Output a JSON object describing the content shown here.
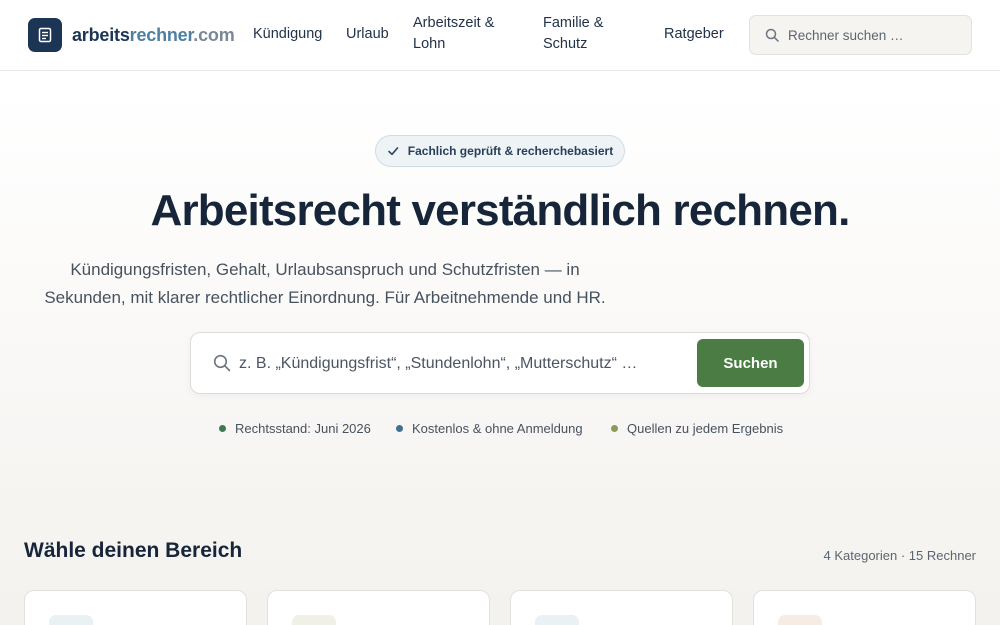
{
  "logo": {
    "part1": "arbeits",
    "part2": "rechner",
    "part3": ".com",
    "icon": "document-icon"
  },
  "nav": {
    "items": [
      {
        "label": "Kündigung"
      },
      {
        "label": "Urlaub"
      },
      {
        "label": "Arbeitszeit &",
        "label2": "Lohn"
      },
      {
        "label": "Familie &",
        "label2": "Schutz"
      },
      {
        "label": "Ratgeber"
      }
    ],
    "search_placeholder": "Rechner suchen …"
  },
  "hero": {
    "badge": "Fachlich geprüft & recherchebasiert",
    "title": "Arbeitsrecht verständlich rechnen.",
    "subtitle_line1": "Kündigungsfristen, Gehalt, Urlaubsanspruch und Schutzfristen — in",
    "subtitle_line2": "Sekunden, mit klarer rechtlicher Einordnung. Für Arbeitnehmende und HR.",
    "search_placeholder": "z. B. „Kündigungsfrist“, „Stundenlohn“, „Mutterschutz“ …",
    "search_button": "Suchen",
    "features": [
      {
        "label": "Rechtsstand: Juni 2026",
        "color": "#3f7a4f"
      },
      {
        "label": "Kostenlos & ohne Anmeldung",
        "color": "#3f6f93"
      },
      {
        "label": "Quellen zu jedem Ergebnis",
        "color": "#8a9a5b"
      }
    ]
  },
  "section": {
    "title": "Wähle deinen Bereich",
    "meta": "4 Kategorien · 15 Rechner",
    "card_chip_colors": [
      "#eaf1f5",
      "#f1f0e6",
      "#eaf1f5",
      "#f6ece4"
    ]
  },
  "colors": {
    "brand": "#1d3554",
    "accent": "#4e7fa0",
    "button": "#4a7c43"
  }
}
